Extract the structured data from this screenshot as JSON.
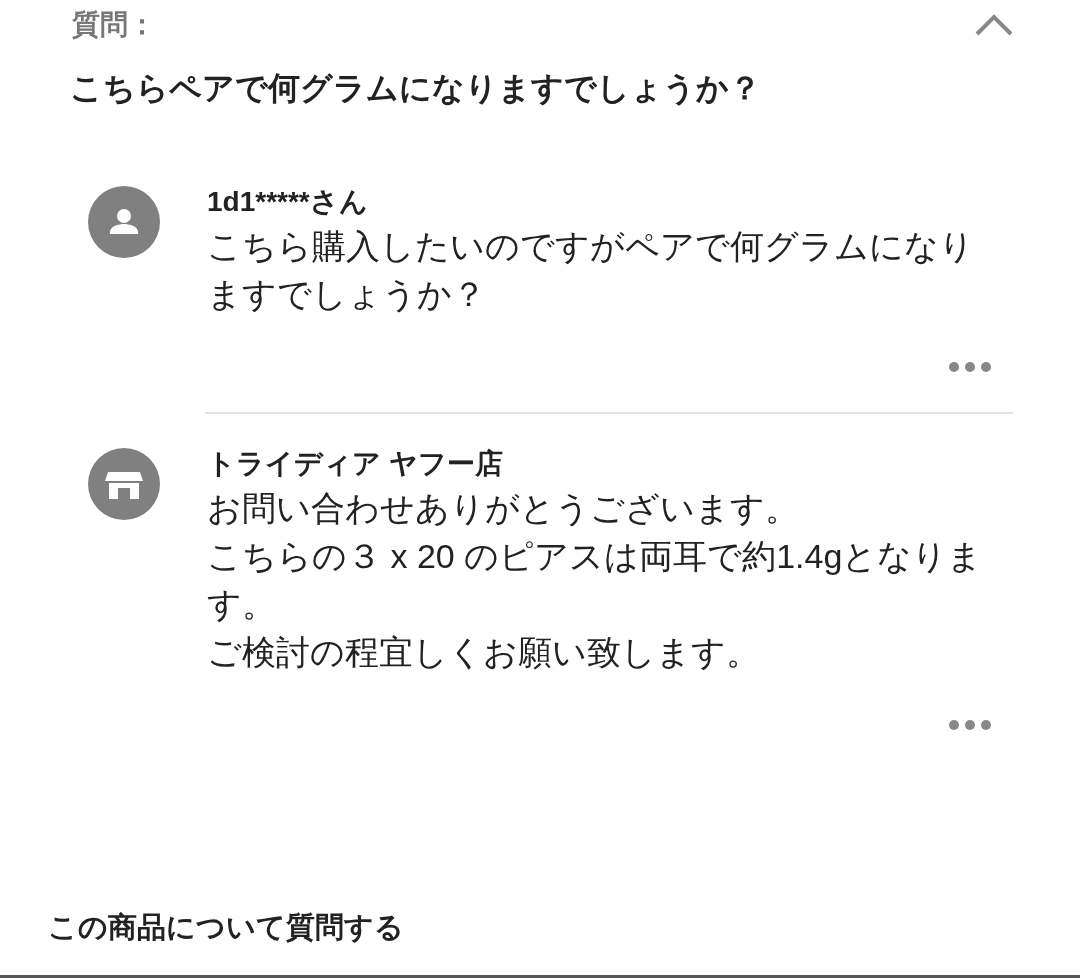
{
  "header": {
    "label": "質問：",
    "expanded": true
  },
  "question_title": "こちらペアで何グラムになりますでしょうか？",
  "messages": [
    {
      "kind": "user",
      "author": "1d1*****さん",
      "paragraphs": [
        "こちら購入したいのですがペアで何グラムになりますでしょうか？"
      ]
    },
    {
      "kind": "store",
      "author": "トライディア ヤフー店",
      "paragraphs": [
        "お問い合わせありがとうございます。",
        "こちらの３ x 20 のピアスは両耳で約1.4gとなります。",
        "ご検討の程宜しくお願い致します。"
      ]
    }
  ],
  "ask_link": "この商品について質問する"
}
